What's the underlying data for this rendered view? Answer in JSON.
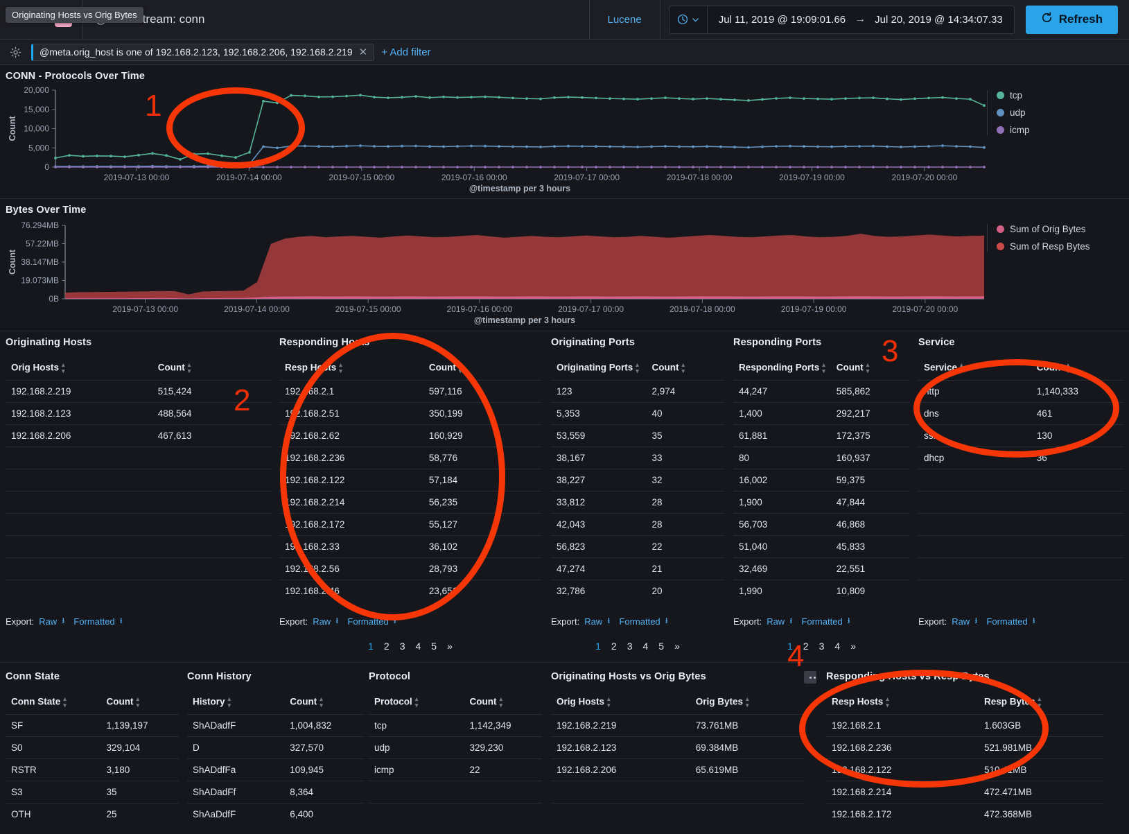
{
  "tooltip": {
    "text": "Originating Hosts vs Orig Bytes"
  },
  "topbar": {
    "filters_label": "Filters",
    "filter_count": "1",
    "query": "@meta.stream: conn",
    "lucene": "Lucene",
    "time_from": "Jul 11, 2019 @ 19:09:01.66",
    "time_arrow": "→",
    "time_to": "Jul 20, 2019 @ 14:34:07.33",
    "refresh": "Refresh",
    "clock_icon": "clock-icon",
    "chevron_icon": "chevron-down-icon",
    "refresh_icon": "refresh-icon"
  },
  "filterbar": {
    "gear_icon": "gear-icon",
    "pill_text": "@meta.orig_host is one of 192.168.2.123, 192.168.2.206, 192.168.2.219",
    "pill_close": "✕",
    "add_filter": "+ Add filter"
  },
  "chart_data": [
    {
      "type": "line",
      "title": "CONN - Protocols Over Time",
      "xlabel": "@timestamp per 3 hours",
      "ylabel": "Count",
      "ylim": [
        0,
        22000
      ],
      "yticks": [
        "0",
        "5,000",
        "10,000",
        "15,000",
        "20,000"
      ],
      "xticks": [
        "2019-07-13 00:00",
        "2019-07-14 00:00",
        "2019-07-15 00:00",
        "2019-07-16 00:00",
        "2019-07-17 00:00",
        "2019-07-18 00:00",
        "2019-07-19 00:00",
        "2019-07-20 00:00"
      ],
      "legend_position": "right",
      "series": [
        {
          "name": "tcp",
          "color": "#54b399",
          "values": [
            2600,
            3350,
            3100,
            3200,
            3150,
            2950,
            3400,
            3900,
            3300,
            2200,
            3700,
            3850,
            3250,
            2750,
            4200,
            18850,
            18350,
            20500,
            20350,
            20050,
            20100,
            20300,
            20550,
            20000,
            19800,
            19950,
            20200,
            19850,
            20050,
            19900,
            20000,
            20100,
            19950,
            19750,
            19600,
            19500,
            19850,
            20000,
            19900,
            19750,
            19600,
            19500,
            19400,
            19600,
            19800,
            19600,
            19450,
            19600,
            19400,
            19200,
            19050,
            19350,
            19650,
            19800,
            19600,
            19500,
            19400,
            19600,
            19750,
            19800,
            19500,
            19300,
            19550,
            19750,
            19900,
            19600,
            19400,
            17600
          ]
        },
        {
          "name": "udp",
          "color": "#6092c0",
          "values": [
            150,
            180,
            160,
            190,
            170,
            160,
            200,
            250,
            210,
            150,
            230,
            260,
            240,
            200,
            900,
            5850,
            5500,
            6000,
            6050,
            5900,
            5850,
            6000,
            6100,
            5950,
            5900,
            6000,
            6050,
            5900,
            5850,
            5950,
            6050,
            6000,
            5900,
            5850,
            5800,
            5750,
            5900,
            6000,
            5950,
            5900,
            5850,
            5800,
            5750,
            5850,
            5950,
            5850,
            5800,
            5900,
            5800,
            5700,
            5650,
            5800,
            5950,
            6000,
            5900,
            5850,
            5800,
            5900,
            5950,
            6000,
            5850,
            5750,
            5850,
            5950,
            6100,
            5950,
            5850,
            5600
          ]
        },
        {
          "name": "icmp",
          "color": "#9170b8",
          "values": [
            2,
            1,
            0,
            1,
            0,
            0,
            1,
            2,
            1,
            0,
            1,
            1,
            1,
            0,
            2,
            3,
            2,
            3,
            3,
            2,
            3,
            2,
            3,
            2,
            3,
            2,
            3,
            2,
            3,
            2,
            3,
            2,
            3,
            2,
            3,
            2,
            3,
            2,
            3,
            2,
            3,
            2,
            3,
            2,
            3,
            2,
            3,
            2,
            3,
            2,
            3,
            2,
            3,
            2,
            3,
            2,
            3,
            2,
            3,
            2,
            3,
            2,
            3,
            2,
            3,
            2,
            3,
            2
          ]
        }
      ]
    },
    {
      "type": "area",
      "title": "Bytes Over Time",
      "xlabel": "@timestamp per 3 hours",
      "ylabel": "Count",
      "ylim": [
        0,
        83000000
      ],
      "yticks": [
        "0B",
        "19.073MB",
        "38.147MB",
        "57.22MB",
        "76.294MB"
      ],
      "xticks": [
        "2019-07-13 00:00",
        "2019-07-14 00:00",
        "2019-07-15 00:00",
        "2019-07-16 00:00",
        "2019-07-17 00:00",
        "2019-07-18 00:00",
        "2019-07-19 00:00",
        "2019-07-20 00:00"
      ],
      "legend_position": "right",
      "series": [
        {
          "name": "Sum of Resp Bytes",
          "color": "#a23c3c",
          "values": [
            7.0,
            7.5,
            7.6,
            7.8,
            7.9,
            8.2,
            8.4,
            8.8,
            8.6,
            5.0,
            8.2,
            8.6,
            8.9,
            9.2,
            19.0,
            62.0,
            68.0,
            70.0,
            71.0,
            69.5,
            70.5,
            71.0,
            70.0,
            69.0,
            70.5,
            71.5,
            70.5,
            69.5,
            70.0,
            71.0,
            72.0,
            70.5,
            69.0,
            70.0,
            71.0,
            70.0,
            69.5,
            70.5,
            71.5,
            70.5,
            69.5,
            70.0,
            71.0,
            70.0,
            69.0,
            70.0,
            71.0,
            72.0,
            71.0,
            70.0,
            69.5,
            70.5,
            71.5,
            72.0,
            70.5,
            69.5,
            70.0,
            71.0,
            73.5,
            71.0,
            70.0,
            70.5,
            71.5,
            72.5,
            71.5,
            70.5,
            71.0,
            71.5
          ]
        },
        {
          "name": "Sum of Orig Bytes",
          "color": "#d36086",
          "values": [
            0.6,
            0.7,
            0.7,
            0.7,
            0.7,
            0.8,
            0.8,
            0.9,
            0.8,
            0.5,
            0.8,
            0.8,
            0.9,
            0.9,
            1.6,
            2.4,
            2.6,
            2.7,
            2.8,
            2.7,
            2.7,
            2.8,
            2.7,
            2.6,
            2.7,
            2.8,
            2.7,
            2.6,
            2.7,
            2.8,
            2.8,
            2.7,
            2.6,
            2.7,
            2.8,
            2.7,
            2.6,
            2.7,
            2.8,
            2.7,
            2.6,
            2.7,
            2.8,
            2.7,
            2.6,
            2.7,
            2.8,
            2.8,
            2.8,
            2.7,
            2.6,
            2.7,
            2.8,
            2.8,
            2.7,
            2.6,
            2.7,
            2.8,
            2.9,
            2.8,
            2.7,
            2.7,
            2.8,
            2.9,
            2.8,
            2.7,
            2.8,
            2.8
          ]
        }
      ]
    }
  ],
  "tables": {
    "originating_hosts": {
      "title": "Originating Hosts",
      "columns": [
        "Orig Hosts",
        "Count"
      ],
      "rows": [
        [
          "192.168.2.219",
          "515,424"
        ],
        [
          "192.168.2.123",
          "488,564"
        ],
        [
          "192.168.2.206",
          "467,613"
        ]
      ],
      "blank_rows": 7,
      "export_label": "Export:",
      "export_raw": "Raw",
      "export_formatted": "Formatted",
      "pager": []
    },
    "responding_hosts": {
      "title": "Responding Hosts",
      "columns": [
        "Resp Hosts",
        "Count"
      ],
      "rows": [
        [
          "192.168.2.1",
          "597,116"
        ],
        [
          "192.168.2.51",
          "350,199"
        ],
        [
          "192.168.2.62",
          "160,929"
        ],
        [
          "192.168.2.236",
          "58,776"
        ],
        [
          "192.168.2.122",
          "57,184"
        ],
        [
          "192.168.2.214",
          "56,235"
        ],
        [
          "192.168.2.172",
          "55,127"
        ],
        [
          "192.168.2.33",
          "36,102"
        ],
        [
          "192.168.2.56",
          "28,793"
        ],
        [
          "192.168.2.46",
          "23,651"
        ]
      ],
      "blank_rows": 0,
      "export_label": "Export:",
      "export_raw": "Raw",
      "export_formatted": "Formatted",
      "pager": [
        "1",
        "2",
        "3",
        "4",
        "5",
        "»"
      ]
    },
    "originating_ports": {
      "title": "Originating Ports",
      "columns": [
        "Originating Ports",
        "Count"
      ],
      "rows": [
        [
          "123",
          "2,974"
        ],
        [
          "5,353",
          "40"
        ],
        [
          "53,559",
          "35"
        ],
        [
          "38,167",
          "33"
        ],
        [
          "38,227",
          "32"
        ],
        [
          "33,812",
          "28"
        ],
        [
          "42,043",
          "28"
        ],
        [
          "56,823",
          "22"
        ],
        [
          "47,274",
          "21"
        ],
        [
          "32,786",
          "20"
        ]
      ],
      "blank_rows": 0,
      "export_label": "Export:",
      "export_raw": "Raw",
      "export_formatted": "Formatted",
      "pager": [
        "1",
        "2",
        "3",
        "4",
        "5",
        "»"
      ]
    },
    "responding_ports": {
      "title": "Responding Ports",
      "columns": [
        "Responding Ports",
        "Count"
      ],
      "rows": [
        [
          "44,247",
          "585,862"
        ],
        [
          "1,400",
          "292,217"
        ],
        [
          "61,881",
          "172,375"
        ],
        [
          "80",
          "160,937"
        ],
        [
          "16,002",
          "59,375"
        ],
        [
          "1,900",
          "47,844"
        ],
        [
          "56,703",
          "46,868"
        ],
        [
          "51,040",
          "45,833"
        ],
        [
          "32,469",
          "22,551"
        ],
        [
          "1,990",
          "10,809"
        ]
      ],
      "blank_rows": 0,
      "export_label": "Export:",
      "export_raw": "Raw",
      "export_formatted": "Formatted",
      "pager": [
        "1",
        "2",
        "3",
        "4",
        "»"
      ]
    },
    "service": {
      "title": "Service",
      "columns": [
        "Service",
        "Count"
      ],
      "rows": [
        [
          "http",
          "1,140,333"
        ],
        [
          "dns",
          "461"
        ],
        [
          "ssl",
          "130"
        ],
        [
          "dhcp",
          "36"
        ]
      ],
      "blank_rows": 6,
      "export_label": "Export:",
      "export_raw": "Raw",
      "export_formatted": "Formatted",
      "pager": []
    },
    "conn_state": {
      "title": "Conn State",
      "columns": [
        "Conn State",
        "Count"
      ],
      "rows": [
        [
          "SF",
          "1,139,197"
        ],
        [
          "S0",
          "329,104"
        ],
        [
          "RSTR",
          "3,180"
        ],
        [
          "S3",
          "35"
        ],
        [
          "OTH",
          "25"
        ]
      ]
    },
    "conn_history": {
      "title": "Conn History",
      "columns": [
        "History",
        "Count"
      ],
      "rows": [
        [
          "ShADadfF",
          "1,004,832"
        ],
        [
          "D",
          "327,570"
        ],
        [
          "ShADdfFa",
          "109,945"
        ],
        [
          "ShADadFf",
          "8,364"
        ],
        [
          "ShAaDdfF",
          "6,400"
        ]
      ]
    },
    "protocol": {
      "title": "Protocol",
      "columns": [
        "Protocol",
        "Count"
      ],
      "rows": [
        [
          "tcp",
          "1,142,349"
        ],
        [
          "udp",
          "329,230"
        ],
        [
          "icmp",
          "22"
        ]
      ],
      "blank_rows": 2
    },
    "orig_hosts_vs_orig_bytes": {
      "title": "Originating Hosts vs Orig Bytes",
      "columns": [
        "Orig Hosts",
        "Orig Bytes"
      ],
      "rows": [
        [
          "192.168.2.219",
          "73.761MB"
        ],
        [
          "192.168.2.123",
          "69.384MB"
        ],
        [
          "192.168.2.206",
          "65.619MB"
        ]
      ],
      "blank_rows": 2
    },
    "resp_hosts_vs_resp_bytes": {
      "title": "Responding Hosts vs Resp Bytes",
      "columns": [
        "Resp Hosts",
        "Resp Bytes"
      ],
      "rows": [
        [
          "192.168.2.1",
          "1.603GB"
        ],
        [
          "192.168.2.236",
          "521.981MB"
        ],
        [
          "192.168.2.122",
          "510.41MB"
        ],
        [
          "192.168.2.214",
          "472.471MB"
        ],
        [
          "192.168.2.172",
          "472.368MB"
        ]
      ]
    }
  },
  "annotations": [
    {
      "number": "1"
    },
    {
      "number": "2"
    },
    {
      "number": "3"
    },
    {
      "number": "4"
    }
  ],
  "colors": {
    "accent": "#2aa3e8",
    "link": "#53b2f5",
    "tcp": "#54b399",
    "udp": "#6092c0",
    "icmp": "#9170b8",
    "orig_bytes": "#d36086",
    "resp_bytes": "#a23c3c",
    "annotation": "#f63607",
    "background": "#16171c"
  }
}
